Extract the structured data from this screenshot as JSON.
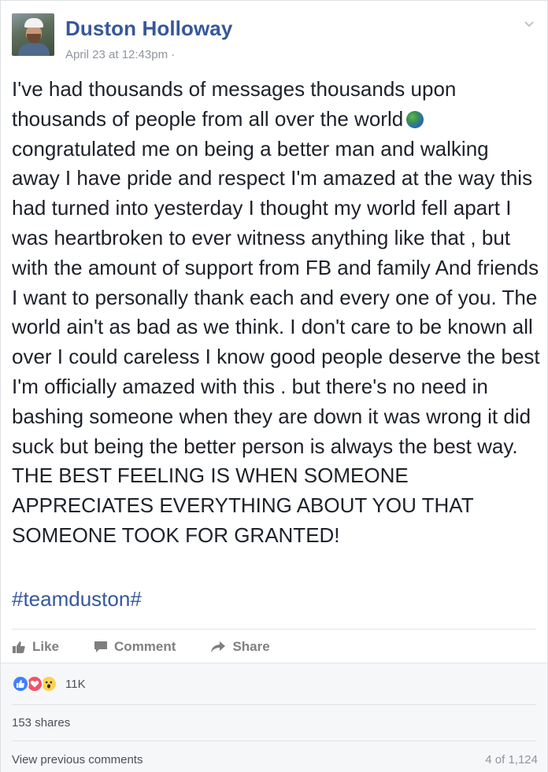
{
  "post": {
    "author": "Duston Holloway",
    "timestamp": "April 23 at 12:43pm",
    "meta_separator": "·",
    "body_before_emoji": "I've had thousands of messages thousands upon thousands of people from all over the world",
    "body_emoji": "globe-emoji",
    "body_after_emoji": "congratulated me on being a better man and walking away I have pride and respect I'm amazed at the way this had turned into yesterday I thought my world fell apart I was heartbroken to ever witness anything like that , but with the amount of support from FB and family And friends I want to personally thank each and every one of you. The world ain't as bad as we think. I don't care to be known all over I could careless I know good people deserve the best I'm officially amazed with this . but there's no need in bashing someone when they are down it was wrong it did suck but being the better person is always the best way. THE BEST FEELING IS WHEN SOMEONE APPRECIATES EVERYTHING ABOUT YOU THAT SOMEONE TOOK FOR GRANTED!",
    "hashtag": "#teamduston#"
  },
  "actions": {
    "like": "Like",
    "comment": "Comment",
    "share": "Share"
  },
  "footer": {
    "reactions": [
      "like",
      "love",
      "wow"
    ],
    "reaction_count": "11K",
    "shares": "153 shares",
    "view_previous": "View previous comments",
    "pager": "4 of 1,124"
  },
  "colors": {
    "link_blue": "#365899",
    "muted": "#90949c",
    "footer_bg": "#f6f7f9"
  }
}
